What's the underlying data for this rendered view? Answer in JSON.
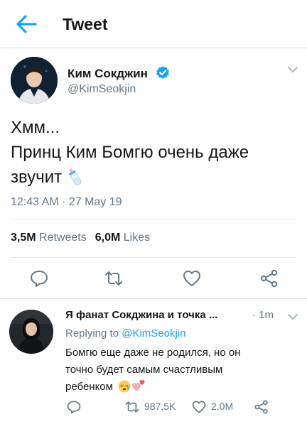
{
  "header": {
    "title": "Tweet",
    "back_icon": "arrow-left-icon",
    "accent": "#1da1f2"
  },
  "tweet": {
    "author_name": "Ким Сокджин",
    "author_handle": "@KimSeokjin",
    "verified": true,
    "text_lines": [
      "Хмм...",
      "Принц Ким Бомгю очень даже",
      "звучит"
    ],
    "emoji": "baby-bottle-icon",
    "timestamp": "12:43 AM · 27 May 19",
    "retweets_count": "3,5M",
    "retweets_label": "Retweets",
    "likes_count": "6,0M",
    "likes_label": "Likes",
    "actions": [
      "reply-icon",
      "retweet-icon",
      "like-icon",
      "share-icon"
    ]
  },
  "reply": {
    "author_name": "Я фанат Сокджина и точка ...",
    "time": "· 1m",
    "replying_prefix": "Replying to",
    "replying_to": "@KimSeokjin",
    "text_lines": [
      "Бомгю еще даже не родился, но он",
      "точно будет самым счастливым",
      "ребенком"
    ],
    "emojis": [
      "sleeping-face-icon",
      "two-hearts-icon"
    ],
    "retweets_count": "987,5K",
    "likes_count": "2,0M"
  },
  "colors": {
    "text": "#14171a",
    "secondary": "#657786",
    "accent": "#1da1f2",
    "divider": "#e1e8ed"
  }
}
